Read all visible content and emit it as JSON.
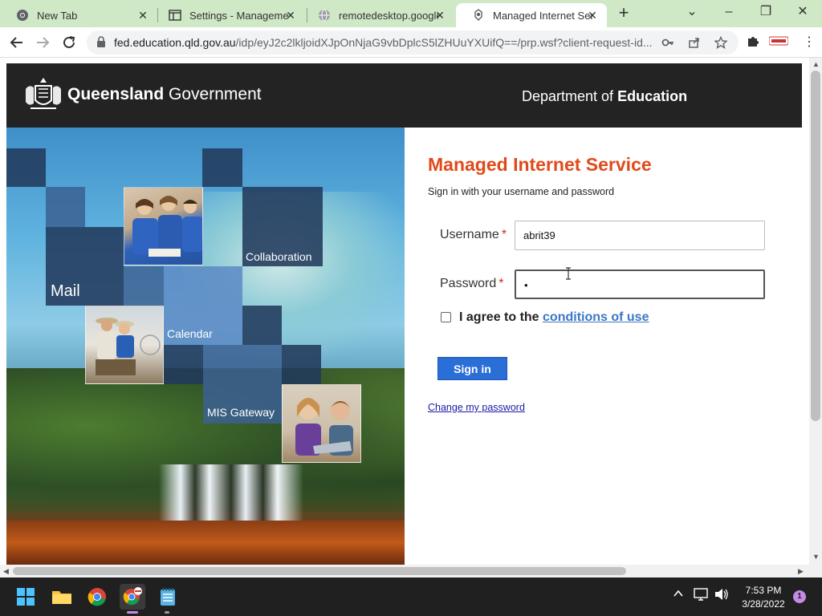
{
  "browser": {
    "tabs": [
      {
        "label": "New Tab",
        "icon": "chrome-icon"
      },
      {
        "label": "Settings - Managemen",
        "icon": "settings-page-icon"
      },
      {
        "label": "remotedesktop.google",
        "icon": "globe-icon"
      },
      {
        "label": "Managed Internet Serv",
        "icon": "qld-crest-icon"
      }
    ],
    "url_host": "fed.education.qld.gov.au",
    "url_path": "/idp/eyJ2c2lkljoidXJpOnNjaG9vbDplcS5lZHUuYXUifQ==/prp.wsf?client-request-id..."
  },
  "header": {
    "gov_title_bold": "Queensland",
    "gov_title_regular": "Government",
    "dept_prefix": "Department of",
    "dept_bold": "Education"
  },
  "hero": {
    "tiles": {
      "collaboration": "Collaboration",
      "mail": "Mail",
      "calendar": "Calendar",
      "mis_gateway": "MIS Gateway"
    }
  },
  "form": {
    "title": "Managed Internet Service",
    "subtitle": "Sign in with your username and password",
    "username_label": "Username",
    "username_value": "abrit39",
    "password_label": "Password",
    "password_value": "•",
    "required_mark": "*",
    "agree_text": "I agree to the",
    "agree_link": "conditions of use",
    "signin_label": "Sign in",
    "change_password": "Change my password"
  },
  "taskbar": {
    "time": "7:53 PM",
    "date": "3/28/2022",
    "notifications": "1"
  },
  "colors": {
    "accent_title": "#e04a1b",
    "signin_button": "#2a6ed8",
    "header_bg": "#232323",
    "tabstrip_bg": "#cfe8c6"
  }
}
